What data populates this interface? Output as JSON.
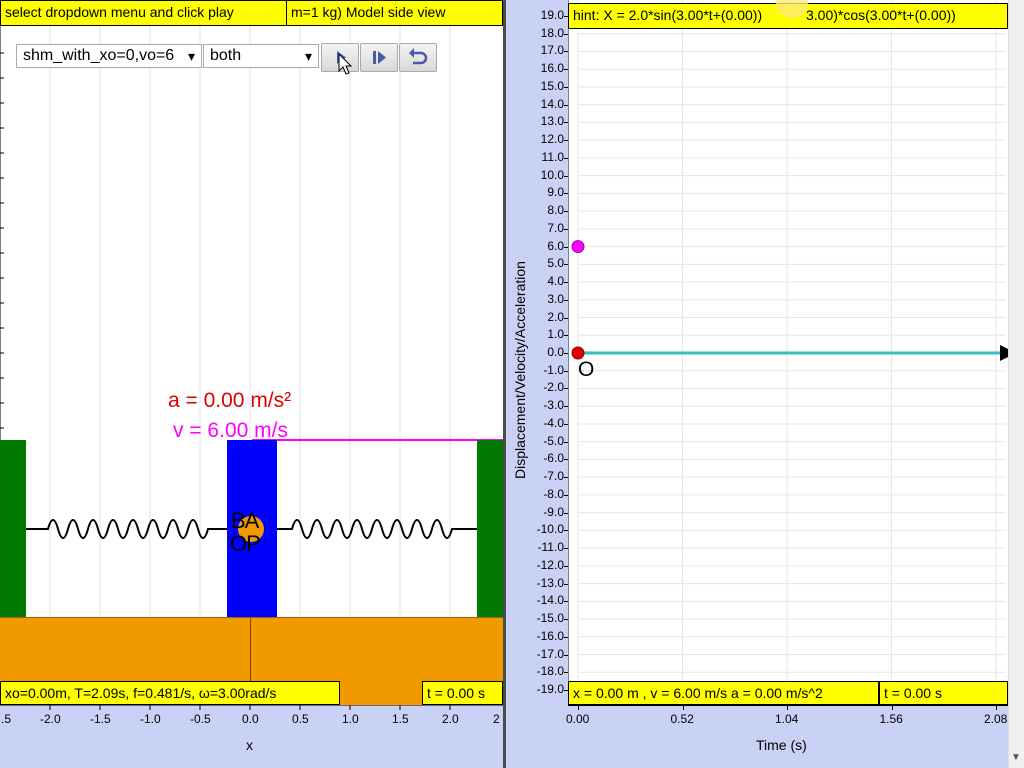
{
  "left_panel": {
    "instruction": "select dropdown menu and click play",
    "title": "m=1 kg) Model side view",
    "dropdown_model": {
      "selected": "shm_with_xo=0,vo=6",
      "arrow": "▾"
    },
    "dropdown_mode": {
      "selected": "both",
      "arrow": "▾"
    },
    "buttons": {
      "play_icon": "play-icon",
      "step_icon": "step-forward-icon",
      "reset_icon": "reset-icon"
    },
    "acceleration_label": "a = 0.00 m/s²",
    "velocity_label": "v = 6.00 m/s",
    "block_letters_top": "BA",
    "block_letters_bottom": "OP",
    "info_text": "xo=0.00m, T=2.09s, f=0.481/s, ω=3.00rad/s",
    "time_text": "t = 0.00 s",
    "x_axis_label": "x",
    "x_ticks": [
      ".5",
      "-2.0",
      "-1.5",
      "-1.0",
      "-0.5",
      "0.0",
      "0.5",
      "1.0",
      "1.5",
      "2.0",
      "2"
    ]
  },
  "right_panel": {
    "hint_text": "hint: X = 2.0*sin(3.00*t+(0.00))",
    "hint_text_2": "3.00)*cos(3.00*t+(0.00))",
    "y_axis_label": "Displacement/Velocity/Acceleration",
    "x_axis_label": "Time (s)",
    "status_text": "x = 0.00 m , v = 6.00 m/s a = 0.00 m/s^2",
    "time_text": "t = 0.00 s",
    "origin_label": "O"
  },
  "colors": {
    "yellow": "#ffff00",
    "axis_band": "#c9d1f4",
    "green_wall": "#007a00",
    "blue_block": "#0000ff",
    "orange_floor": "#f09a00",
    "accel_red": "#e00000",
    "velocity_magenta": "#ff00ff",
    "cyan_line": "#30c0c0"
  },
  "chart_data": {
    "type": "scatter",
    "x": [
      0.0,
      0.0
    ],
    "series": [
      {
        "values": [
          6.0
        ]
      },
      {
        "values": [
          0.0
        ]
      }
    ],
    "x_ticks": [
      "0.00",
      "0.52",
      "1.04",
      "1.56",
      "2.08"
    ],
    "y_ticks": [
      "19.0",
      "18.0",
      "17.0",
      "16.0",
      "15.0",
      "14.0",
      "13.0",
      "12.0",
      "11.0",
      "10.0",
      "9.0",
      "8.0",
      "7.0",
      "6.0",
      "5.0",
      "4.0",
      "3.0",
      "2.0",
      "1.0",
      "0.0",
      "-1.0",
      "-2.0",
      "-3.0",
      "-4.0",
      "-5.0",
      "-6.0",
      "-7.0",
      "-8.0",
      "-9.0",
      "-10.0",
      "-11.0",
      "-12.0",
      "-13.0",
      "-14.0",
      "-15.0",
      "-16.0",
      "-17.0",
      "-18.0",
      "-19.0"
    ],
    "xlim": [
      0,
      2.08
    ],
    "ylim": [
      -19,
      19
    ],
    "grid": true
  }
}
